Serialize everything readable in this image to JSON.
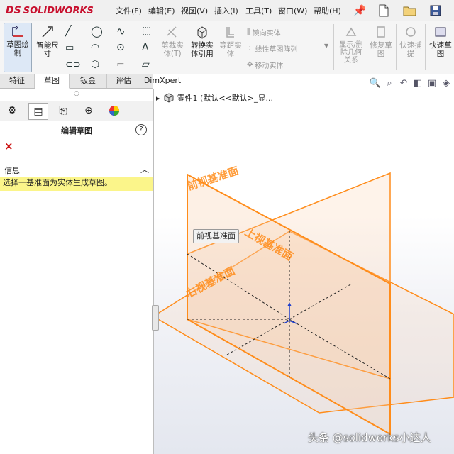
{
  "app": {
    "logo_ds": "DS",
    "logo_solid": "SOLID",
    "logo_works": "WORKS"
  },
  "menu": [
    "文件(F)",
    "编辑(E)",
    "视图(V)",
    "插入(I)",
    "工具(T)",
    "窗口(W)",
    "帮助(H)"
  ],
  "toolbar": {
    "sketch_draw": "草图绘\n制",
    "smart_dim": "智能尺\n寸",
    "trim": "剪裁实\n体(T)",
    "convert": "转换实\n体引用",
    "offset": "等距实\n体",
    "mirror": "镜向实体",
    "linear_pattern": "线性草图阵列",
    "move": "移动实体",
    "show_relations": "显示/删\n除几何\n关系",
    "repair": "修复草\n图",
    "quick_snap": "快速捕\n提",
    "quick_sketch": "快速草\n图"
  },
  "tabs": [
    "特征",
    "草图",
    "钣金",
    "评估",
    "DimXpert"
  ],
  "active_tab": "草图",
  "panel": {
    "title": "编辑草图",
    "help": "?",
    "close": "×",
    "info_title": "信息",
    "info_text": "选择一基准面为实体生成草图。"
  },
  "tree": {
    "arrow": "▸",
    "label": "零件1  (默认<<默认>_显..."
  },
  "planes": {
    "front": "前视基准面",
    "top": "上视基准面",
    "right": "右视基准面"
  },
  "tooltip": "前视基准面",
  "watermark": "头条 @solidworks小达人",
  "colors": {
    "plane": "#ff8c1a",
    "plane_fill": "#f9c9a0",
    "highlight": "#fbf58a",
    "brand": "#c8102e"
  }
}
